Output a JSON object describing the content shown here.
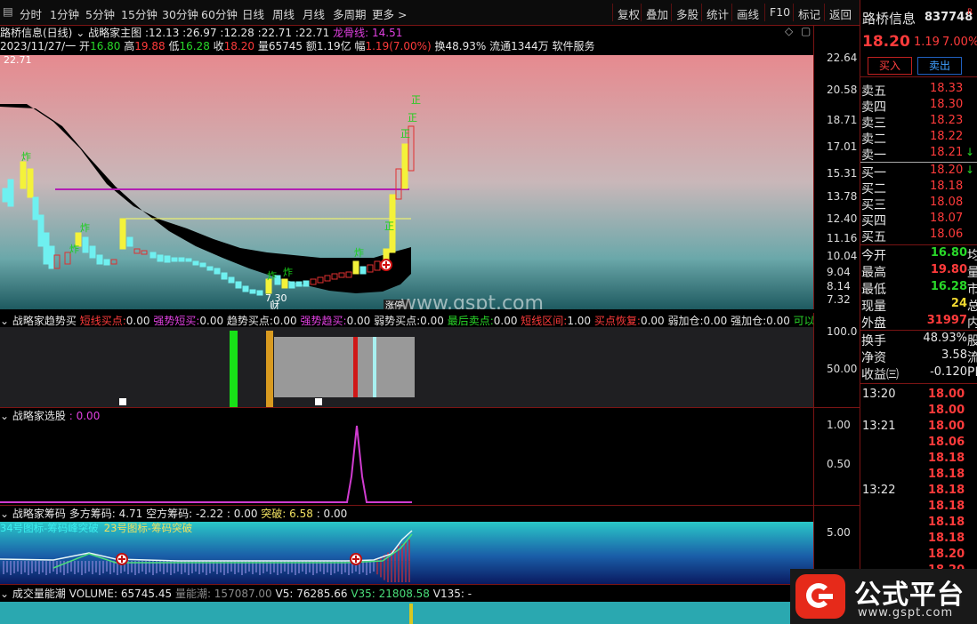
{
  "toolbar": {
    "periods": [
      "分时",
      "1分钟",
      "5分钟",
      "15分钟",
      "30分钟",
      "60分钟",
      "日线",
      "周线",
      "月线",
      "多周期",
      "更多 >"
    ],
    "right": [
      "复权",
      "叠加",
      "多股",
      "统计",
      "画线",
      "F10",
      "标记",
      "返回"
    ]
  },
  "header": {
    "stock_name": "路桥信息",
    "stock_code": "837748",
    "r_badge": "R",
    "last_price": "18.20",
    "change": "1.19",
    "change_pct": "7.00%"
  },
  "chart_title": {
    "symbol": "路桥信息(日线)",
    "indicator": "战略家主图",
    "v1": "12.13",
    "v2": "26.97",
    "v3": "12.28",
    "v4": "22.71",
    "v5": "22.71",
    "dragon_label": "龙骨线:",
    "dragon_value": "14.51"
  },
  "info_line": {
    "date": "2023/11/27/一",
    "open_label": "开",
    "open": "16.80",
    "high_label": "高",
    "high": "19.88",
    "low_label": "低",
    "low": "16.28",
    "close_label": "收",
    "close": "18.20",
    "vol_label": "量",
    "vol": "65745",
    "amount_label": "额",
    "amount": "1.19亿",
    "amp_label": "幅",
    "amp": "1.19(7.00%)",
    "turnover": "换48.93%",
    "float": "流通1344万",
    "sector": "软件服务"
  },
  "main_axis": [
    "22.64",
    "20.58",
    "18.71",
    "17.01",
    "15.31",
    "13.78",
    "12.40",
    "11.16",
    "10.04",
    "9.04",
    "8.14",
    "7.32"
  ],
  "main_marks": {
    "max_label": "22.71",
    "min_label": "7.30",
    "cai_label": "财",
    "zhangting_label": "涨停",
    "zha": "炸",
    "zheng": "正"
  },
  "watermark": "www.gspt.com",
  "ind1": {
    "name": "战略家趋势买",
    "items": [
      {
        "label": "短线买点:",
        "value": "0.00",
        "color": "#ff3b3b"
      },
      {
        "label": "强势短买:",
        "value": "0.00",
        "color": "#e040e0"
      },
      {
        "label": "趋势买点:",
        "value": "0.00",
        "color": "#e6e6e6"
      },
      {
        "label": "强势趋买:",
        "value": "0.00",
        "color": "#e040e0"
      },
      {
        "label": "弱势买点:",
        "value": "0.00",
        "color": "#e6e6e6"
      },
      {
        "label": "最后卖点:",
        "value": "0.00",
        "color": "#29d829"
      },
      {
        "label": "短线区间:",
        "value": "1.00",
        "color": "#ff3b3b"
      },
      {
        "label": "买点恢复:",
        "value": "0.00",
        "color": "#ff3b3b"
      },
      {
        "label": "弱加仓:",
        "value": "0.00",
        "color": "#e6e6e6"
      },
      {
        "label": "强加仓:",
        "value": "0.00",
        "color": "#e6e6e6"
      },
      {
        "label": "可以",
        "value": "",
        "color": "#29d829"
      }
    ],
    "axis": [
      "100.0",
      "50.00"
    ]
  },
  "ind2": {
    "name": "战略家选股",
    "value": "0.00",
    "axis": [
      "1.00",
      "0.50"
    ]
  },
  "ind3": {
    "name": "战略家筹码",
    "t1": "多方筹码: 4.71",
    "t2": "空方筹码: -2.22",
    "t3": ": 0.00",
    "t4": "突破: 6.58",
    "t5": ": 0.00",
    "legend1": "34号图标-筹码峰突破",
    "legend2": "23号图标-筹码突破",
    "axis": [
      "5.00"
    ]
  },
  "ind4": {
    "name": "成交量能潮",
    "vol": "VOLUME: 65745.45",
    "energy": "量能潮: 157087.00",
    "v5": "V5: 76285.66",
    "v35": "V35: 21808.58",
    "v135": "V135: -"
  },
  "right_panel": {
    "buy_btn": "买入",
    "sell_btn": "卖出",
    "asks": [
      {
        "k": "卖五",
        "v": "18.33"
      },
      {
        "k": "卖四",
        "v": "18.30"
      },
      {
        "k": "卖三",
        "v": "18.23"
      },
      {
        "k": "卖二",
        "v": "18.22"
      },
      {
        "k": "卖一",
        "v": "18.21"
      }
    ],
    "bids": [
      {
        "k": "买一",
        "v": "18.20"
      },
      {
        "k": "买二",
        "v": "18.18"
      },
      {
        "k": "买三",
        "v": "18.08"
      },
      {
        "k": "买四",
        "v": "18.07"
      },
      {
        "k": "买五",
        "v": "18.06"
      }
    ],
    "stats": [
      {
        "k": "今开",
        "v": "16.80",
        "c": "#29d829",
        "s": "均"
      },
      {
        "k": "最高",
        "v": "19.80",
        "c": "#ff3b3b",
        "s": "量"
      },
      {
        "k": "最低",
        "v": "16.28",
        "c": "#29d829",
        "s": "市"
      },
      {
        "k": "现量",
        "v": "24",
        "c": "#f0d830",
        "s": "总"
      },
      {
        "k": "外盘",
        "v": "31997",
        "c": "#ff3b3b",
        "s": "内"
      }
    ],
    "stats2": [
      {
        "k": "换手",
        "v": "48.93%",
        "c": "#e6e6e6",
        "s": "股"
      },
      {
        "k": "净资",
        "v": "3.58",
        "c": "#e6e6e6",
        "s": "流"
      },
      {
        "k": "收益㈢",
        "v": "-0.120",
        "c": "#e6e6e6",
        "s": "PE"
      }
    ],
    "ticks": [
      {
        "t": "13:20",
        "v": "18.00"
      },
      {
        "t": "",
        "v": "18.00"
      },
      {
        "t": "13:21",
        "v": "18.00"
      },
      {
        "t": "",
        "v": "18.06"
      },
      {
        "t": "",
        "v": "18.18"
      },
      {
        "t": "",
        "v": "18.18"
      },
      {
        "t": "13:22",
        "v": "18.18"
      },
      {
        "t": "",
        "v": "18.18"
      },
      {
        "t": "",
        "v": "18.18"
      },
      {
        "t": "",
        "v": "18.18"
      },
      {
        "t": "",
        "v": "18.20"
      },
      {
        "t": "",
        "v": "18.20"
      }
    ]
  },
  "logo": {
    "text": "公式平台",
    "url": "www.gspt.com"
  }
}
